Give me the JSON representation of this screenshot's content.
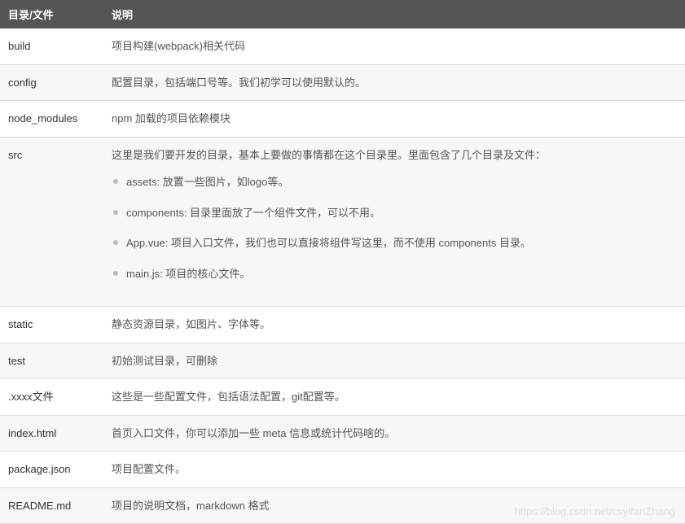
{
  "table": {
    "headers": [
      "目录/文件",
      "说明"
    ],
    "rows": [
      {
        "name": "build",
        "desc": "项目构建(webpack)相关代码"
      },
      {
        "name": "config",
        "desc": "配置目录，包括端口号等。我们初学可以使用默认的。"
      },
      {
        "name": "node_modules",
        "desc": "npm 加载的项目依赖模块"
      },
      {
        "name": "src",
        "desc": "这里是我们要开发的目录，基本上要做的事情都在这个目录里。里面包含了几个目录及文件：",
        "items": [
          "assets: 放置一些图片，如logo等。",
          "components: 目录里面放了一个组件文件，可以不用。",
          "App.vue: 项目入口文件，我们也可以直接将组件写这里，而不使用 components 目录。",
          "main.js: 项目的核心文件。"
        ]
      },
      {
        "name": "static",
        "desc": "静态资源目录，如图片、字体等。"
      },
      {
        "name": "test",
        "desc": "初始测试目录，可删除"
      },
      {
        "name": ".xxxx文件",
        "desc": "这些是一些配置文件，包括语法配置，git配置等。"
      },
      {
        "name": "index.html",
        "desc": "首页入口文件，你可以添加一些 meta 信息或统计代码啥的。"
      },
      {
        "name": "package.json",
        "desc": "项目配置文件。"
      },
      {
        "name": "README.md",
        "desc": "项目的说明文档，markdown 格式"
      }
    ]
  },
  "watermark": "https://blog.csdn.net/csyifanZhang"
}
